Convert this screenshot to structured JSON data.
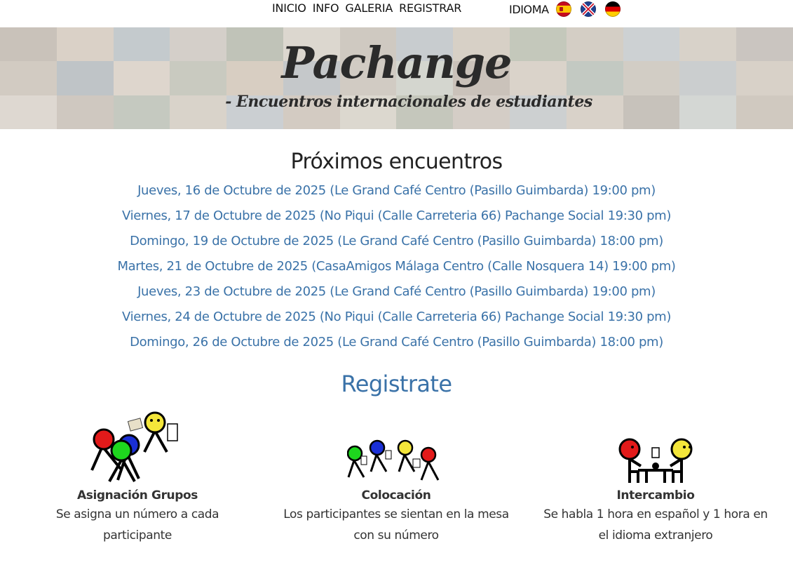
{
  "nav": {
    "links": [
      "INICIO",
      "INFO",
      "GALERIA",
      "REGISTRAR"
    ],
    "language_label": "IDIOMA",
    "flags": [
      "spain-flag-icon",
      "uk-flag-icon",
      "germany-flag-icon"
    ]
  },
  "banner": {
    "title": "Pachange",
    "subtitle": "- Encuentros internacionales de estudiantes"
  },
  "events": {
    "title": "Próximos encuentros",
    "items": [
      "Jueves, 16 de Octubre de 2025 (Le Grand Café Centro (Pasillo Guimbarda) 19:00 pm)",
      "Viernes, 17 de Octubre de 2025 (No Piqui (Calle Carreteria 66) Pachange Social 19:30 pm)",
      "Domingo, 19 de Octubre de 2025 (Le Grand Café Centro (Pasillo Guimbarda) 18:00 pm)",
      "Martes, 21 de Octubre de 2025 (CasaAmigos Málaga Centro (Calle Nosquera 14) 19:00 pm)",
      "Jueves, 23 de Octubre de 2025 (Le Grand Café Centro (Pasillo Guimbarda) 19:00 pm)",
      "Viernes, 24 de Octubre de 2025 (No Piqui (Calle Carreteria 66) Pachange Social 19:30 pm)",
      "Domingo, 26 de Octubre de 2025 (Le Grand Café Centro (Pasillo Guimbarda) 18:00 pm)"
    ]
  },
  "register_label": "Registrate",
  "features": [
    {
      "title": "Asignación Grupos",
      "desc": "Se asigna un número a cada participante",
      "icon": "group-assignment-icon"
    },
    {
      "title": "Colocación",
      "desc": "Los participantes se sientan en la mesa con su número",
      "icon": "seating-icon"
    },
    {
      "title": "Intercambio",
      "desc": "Se habla 1 hora en español y 1 hora en el idioma extranjero",
      "icon": "exchange-icon"
    }
  ],
  "colors": {
    "link": "#3a72a8",
    "text": "#222222"
  }
}
